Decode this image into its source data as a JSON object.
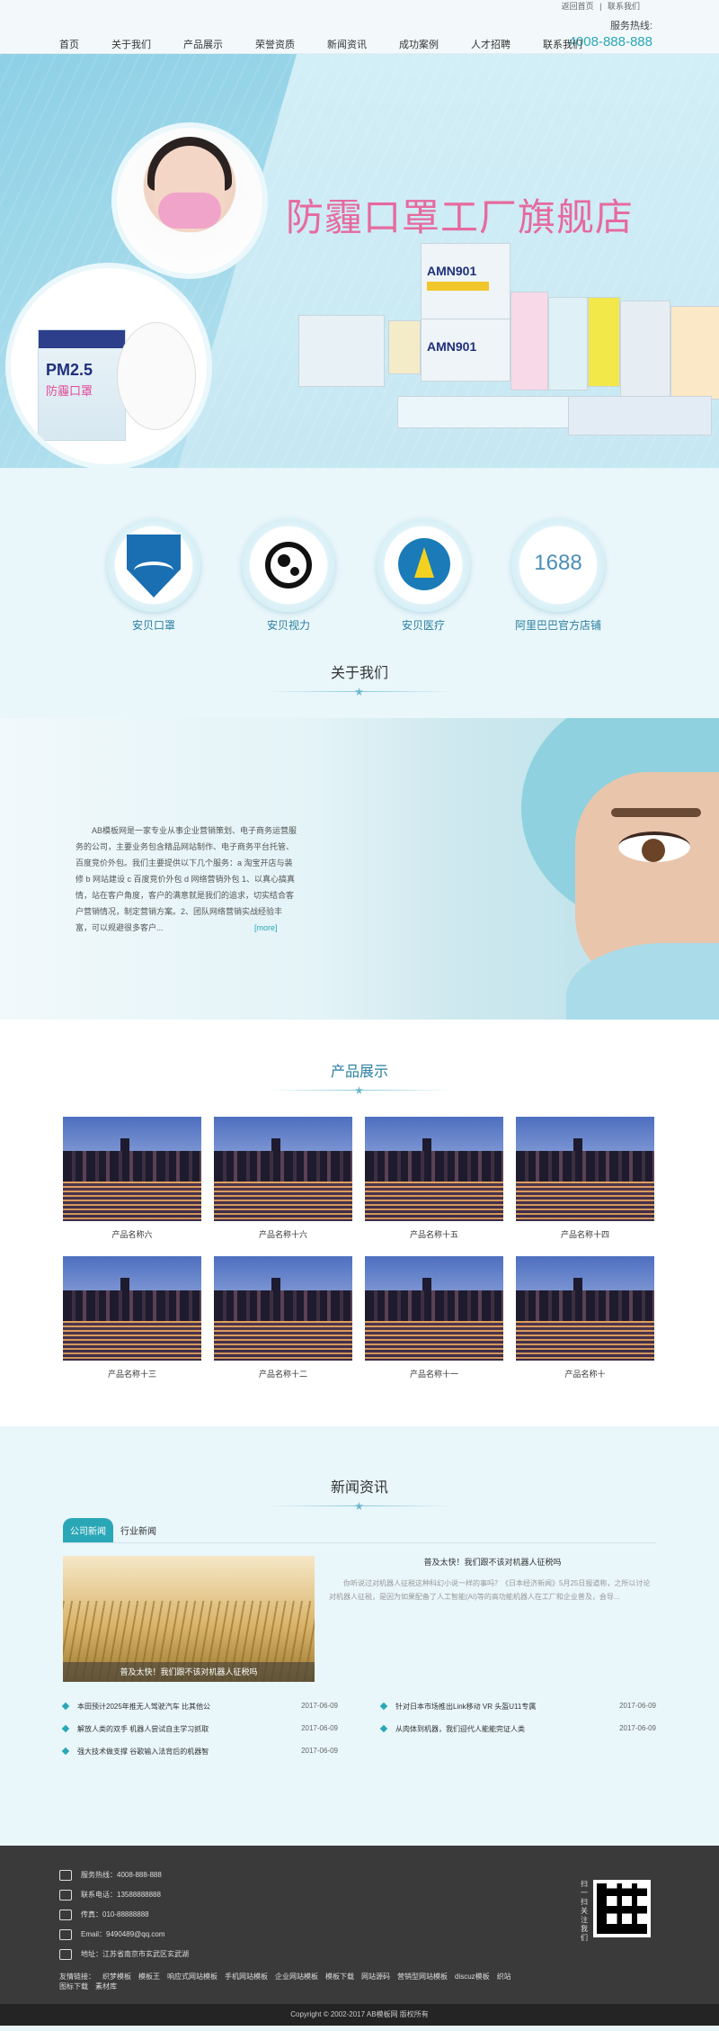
{
  "header": {
    "top_links": [
      "返回首页",
      "|",
      "联系我们"
    ],
    "hotline_label": "服务热线:",
    "hotline_number": "4008-888-888",
    "nav": [
      "首页",
      "关于我们",
      "产品展示",
      "荣誉资质",
      "新闻资讯",
      "成功案例",
      "人才招聘",
      "联系我们"
    ]
  },
  "banner": {
    "title": "防霾口罩工厂旗舰店",
    "pack_text_1": "PM2.5",
    "pack_text_2": "防霾口罩",
    "box_text": "AMN901",
    "slide_count": 3,
    "active_slide": 3
  },
  "brands": [
    {
      "label": "安贝口罩",
      "icon": "shield-logo-icon"
    },
    {
      "label": "安贝视力",
      "icon": "panda-logo-icon"
    },
    {
      "label": "安贝医疗",
      "icon": "sailboat-logo-icon"
    },
    {
      "label": "阿里巴巴官方店铺",
      "icon": "1688-logo-icon",
      "text": "1688"
    }
  ],
  "about": {
    "title": "关于我们",
    "text": "AB模板网是一家专业从事企业营销策划、电子商务运营服务的公司，主要业务包含精品网站制作、电子商务平台托管、百度竞价外包。我们主要提供以下几个服务：a 淘宝开店与装修 b 网站建设 c 百度竞价外包 d 网络营销外包 1、以真心搞真情，站在客户角度，客户的满意就是我们的追求，切实结合客户营销情况，制定营销方案。2、团队网络营销实战经验丰富，可以规避很多客户...",
    "more": "[more]"
  },
  "products": {
    "title": "产品展示",
    "items": [
      "产品名称六",
      "产品名称十六",
      "产品名称十五",
      "产品名称十四",
      "产品名称十三",
      "产品名称十二",
      "产品名称十一",
      "产品名称十"
    ]
  },
  "news": {
    "title": "新闻资讯",
    "tabs": [
      "公司新闻",
      "行业新闻"
    ],
    "featured_caption": "普及太快！我们跟不该对机器人征税吗",
    "featured_title": "普及太快！我们跟不该对机器人征税吗",
    "featured_text": "你听说过对机器人征税这种科幻小说一样的事吗？《日本经济新闻》5月25日报道称，之所以讨论对机器人征税，是因为如果配备了人工智能(AI)等的高功能机器人在工厂和企业普及，会导...",
    "list": [
      {
        "title": "本田预计2025年推无人驾驶汽车 比其他公",
        "date": "2017-06-09"
      },
      {
        "title": "针对日本市场推出Link移动 VR 头盔U11专属",
        "date": "2017-06-09"
      },
      {
        "title": "解放人类的双手 机器人尝试自主学习抓取",
        "date": "2017-06-09"
      },
      {
        "title": "从肉体到机器，我们迎代人能能完证人类",
        "date": "2017-06-09"
      },
      {
        "title": "强大技术做支撑 谷歌输入法背后的机器智",
        "date": "2017-06-09"
      }
    ]
  },
  "footer": {
    "hotline": "服务热线：4008-888-888",
    "phone": "联系电话：13588888888",
    "fax": "传真：010-88888888",
    "email": "Email：9490489@qq.com",
    "address": "地址：江苏省南京市玄武区玄武湖",
    "friends_label": "友情链接：",
    "friends": [
      "织梦模板",
      "模板王",
      "响应式网站模板",
      "手机网站模板",
      "企业网站模板",
      "模板下载",
      "网站源码",
      "营销型网站模板",
      "discuz模板",
      "织站",
      "图标下载",
      "素材库"
    ],
    "qr_label": "扫一扫关注我们",
    "copyright": "Copyright © 2002-2017 AB模板网 版权所有"
  },
  "colors": {
    "accent": "#2aa7b7",
    "footer_bg": "#3a3a3a",
    "banner_title": "#e66a9f"
  }
}
